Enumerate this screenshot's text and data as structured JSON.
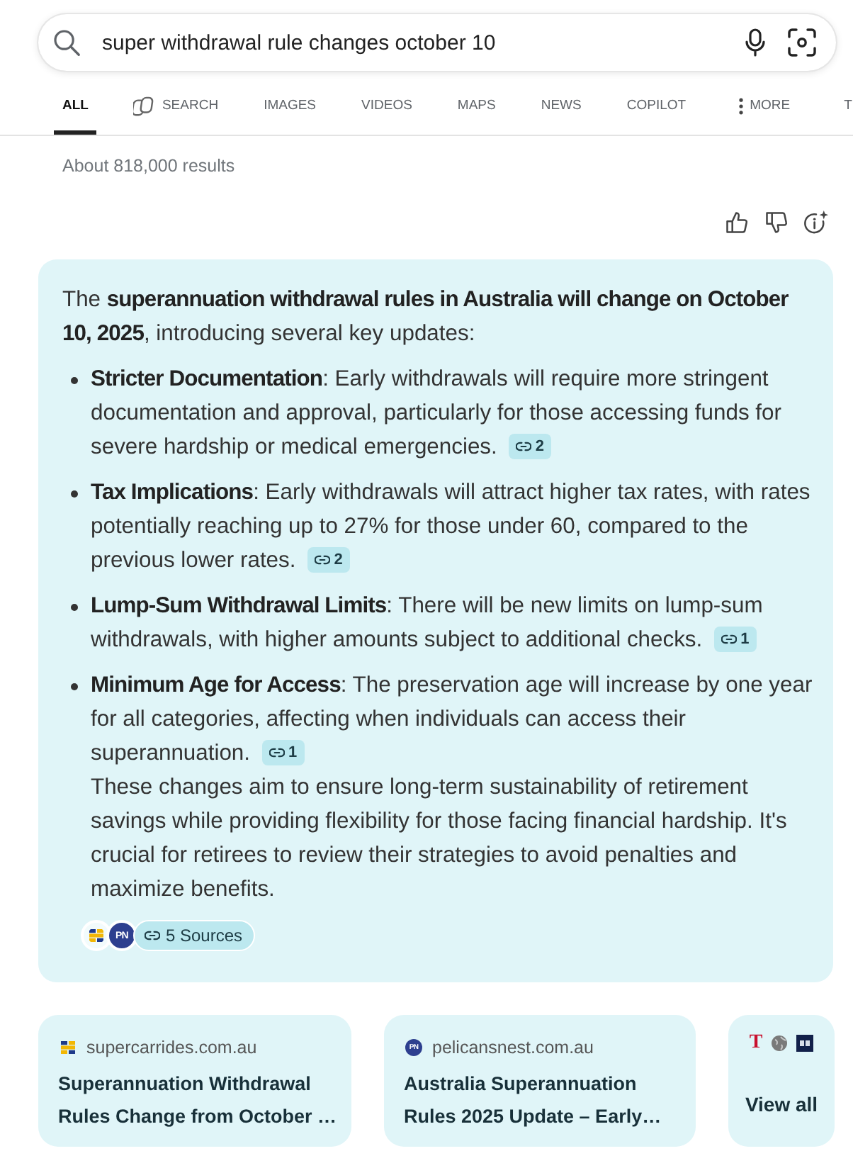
{
  "search": {
    "query": "super withdrawal rule changes october 10"
  },
  "tabs": [
    {
      "label": "ALL",
      "kind": "plain",
      "selected": true
    },
    {
      "label": "SEARCH",
      "kind": "search",
      "selected": false
    },
    {
      "label": "IMAGES",
      "kind": "plain",
      "selected": false
    },
    {
      "label": "VIDEOS",
      "kind": "plain",
      "selected": false
    },
    {
      "label": "MAPS",
      "kind": "plain",
      "selected": false
    },
    {
      "label": "NEWS",
      "kind": "plain",
      "selected": false
    },
    {
      "label": "COPILOT",
      "kind": "plain",
      "selected": false
    },
    {
      "label": "MORE",
      "kind": "more",
      "selected": false
    },
    {
      "label": "T",
      "kind": "plain",
      "selected": false
    }
  ],
  "results_count": "About 818,000 results",
  "answer": {
    "intro": "The **superannuation withdrawal rules in Australia will change on October 10, 2025**, introducing several key updates:",
    "points": [
      {
        "text": "**Stricter Documentation**: Early withdrawals will require more stringent documentation and approval, particularly for those accessing funds for severe hardship or medical emergencies.",
        "citation": "2"
      },
      {
        "text": "**Tax Implications**: Early withdrawals will attract higher tax rates, with rates potentially reaching up to 27% for those under 60, compared to the previous lower rates.",
        "citation": "2"
      },
      {
        "text": "**Lump-Sum Withdrawal Limits**: There will be new limits on lump-sum withdrawals, with higher amounts subject to additional checks.",
        "citation": "1"
      },
      {
        "text": "**Minimum Age for Access**: The preservation age will increase by one year for all categories, affecting when individuals can access their superannuation.",
        "citation": "1"
      }
    ],
    "summary": "These changes aim to ensure long-term sustainability of retirement savings while providing flexibility for those facing financial hardship. It's crucial for retirees to review their strategies to avoid penalties and maximize benefits.",
    "sources": {
      "favicons": [
        {
          "kind": "squares"
        },
        {
          "kind": "initials",
          "text": "PN"
        }
      ],
      "label": "5 Sources"
    }
  },
  "source_cards": [
    {
      "favicon": {
        "kind": "squares"
      },
      "domain": "supercarrides.com.au",
      "title": "Superannuation Withdrawal Rules Change from October …"
    },
    {
      "favicon": {
        "kind": "initials",
        "text": "PN"
      },
      "domain": "pelicansnest.com.au",
      "title": "Australia Superannuation Rules 2025 Update – Early…"
    }
  ],
  "view_all": {
    "favicons": [
      {
        "kind": "letter",
        "text": "T"
      },
      {
        "kind": "globe"
      },
      {
        "kind": "tile"
      }
    ],
    "label": "View all"
  }
}
